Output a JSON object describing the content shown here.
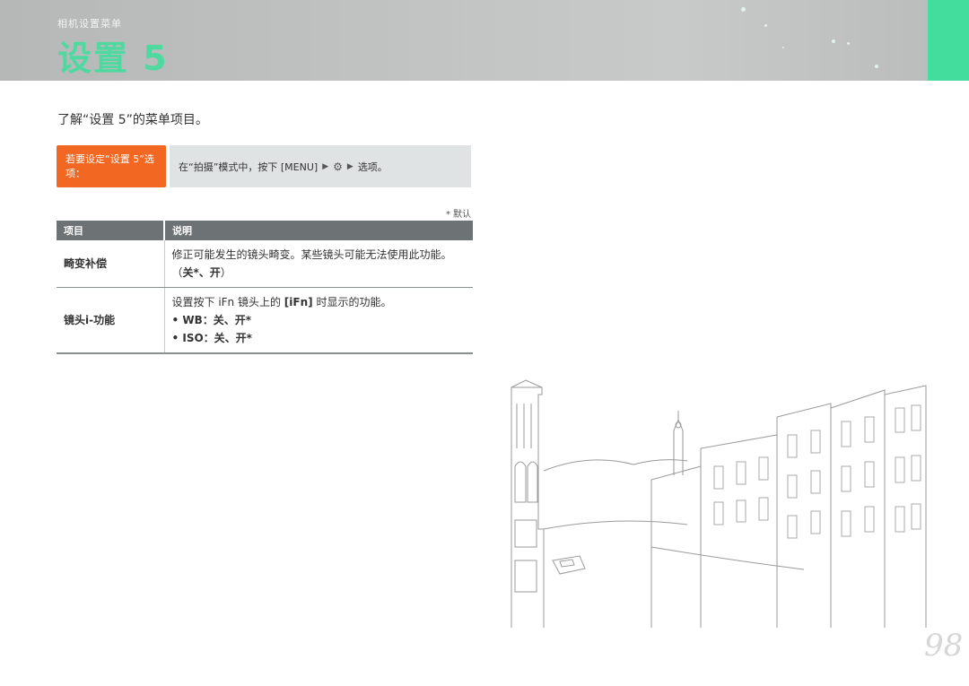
{
  "header": {
    "section_label": "相机设置菜单",
    "page_title": "设置 5"
  },
  "intro": "了解“设置 5”的菜单项目。",
  "howto": {
    "label": "若要设定“设置 5”选项：",
    "prefix": "在“拍摄”模式中，按下 [MENU]",
    "settings_icon": "gear-icon",
    "arrow_icon": "triangle-right-icon",
    "suffix": "选项。"
  },
  "default_note": "* 默认",
  "table": {
    "headers": [
      "项目",
      "说明"
    ],
    "rows": [
      {
        "item": "畸变补偿",
        "desc_main": "修正可能发生的镜头畸变。某些镜头可能无法使用此功能。（",
        "desc_bold": "关*、开",
        "desc_end": "）"
      },
      {
        "item": "镜头i-功能",
        "desc_pre": "设置按下 iFn 镜头上的 ",
        "desc_key": "[iFn]",
        "desc_post": " 时显示的功能。",
        "options": [
          "WB：关、开*",
          "ISO：关、开*"
        ]
      }
    ]
  },
  "page_number": "98",
  "colors": {
    "accent_green": "#43dd9d",
    "heading_green": "#4fd9a0",
    "orange": "#f26722",
    "header_gray": "#c2c4c4",
    "table_header": "#6d7374"
  }
}
